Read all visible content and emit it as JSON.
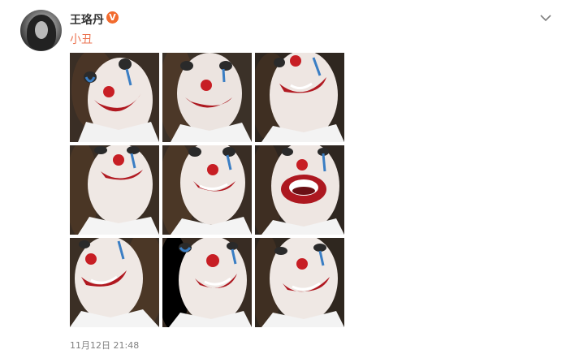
{
  "post": {
    "username": "王珞丹",
    "verified_badge": "V",
    "text": "小丑",
    "timestamp": "11月12日 21:48",
    "more_icon": "chevron-down-icon",
    "colors": {
      "username": "#333333",
      "post_text": "#eb7350",
      "verified_badge": "#f26b2e",
      "timestamp": "#808080"
    }
  },
  "gallery": {
    "image_count": 9,
    "images": [
      {
        "subject": "clown makeup selfie 1"
      },
      {
        "subject": "clown makeup selfie 2"
      },
      {
        "subject": "clown makeup selfie 3"
      },
      {
        "subject": "clown makeup selfie 4"
      },
      {
        "subject": "clown makeup selfie 5"
      },
      {
        "subject": "clown makeup selfie 6"
      },
      {
        "subject": "clown makeup selfie 7"
      },
      {
        "subject": "clown makeup selfie 8"
      },
      {
        "subject": "clown makeup selfie 9"
      }
    ]
  }
}
